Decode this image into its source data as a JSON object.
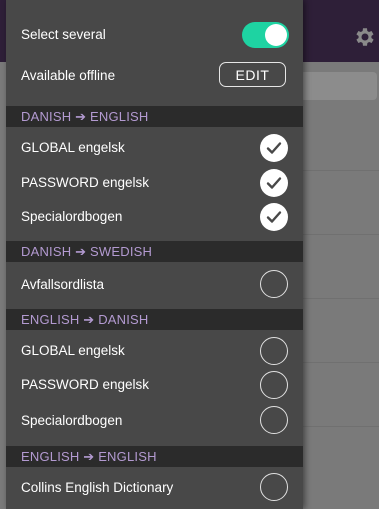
{
  "drawer": {
    "select_several_label": "Select several",
    "select_several_on": true,
    "available_offline_label": "Available offline",
    "edit_label": "EDIT",
    "sections": [
      {
        "title": "DANISH ➔ ENGLISH",
        "items": [
          {
            "label": "GLOBAL engelsk",
            "checked": true
          },
          {
            "label": "PASSWORD engelsk",
            "checked": true
          },
          {
            "label": "Specialordbogen",
            "checked": true
          }
        ]
      },
      {
        "title": "DANISH ➔ SWEDISH",
        "items": [
          {
            "label": "Avfallsordlista",
            "checked": false
          }
        ]
      },
      {
        "title": "ENGLISH ➔ DANISH",
        "items": [
          {
            "label": "GLOBAL engelsk",
            "checked": false
          },
          {
            "label": "PASSWORD engelsk",
            "checked": false
          },
          {
            "label": "Specialordbogen",
            "checked": false
          }
        ]
      },
      {
        "title": "ENGLISH ➔ ENGLISH",
        "items": [
          {
            "label": "Collins English Dictionary",
            "checked": false
          }
        ]
      }
    ]
  },
  "colors": {
    "toggle_on": "#1ed3a2",
    "section_text": "#b39ad1",
    "drawer_bg": "#484848",
    "section_bg": "#2b2b2b"
  },
  "icons": {
    "settings": "gear-icon",
    "checked": "checkmark-circle-icon",
    "unchecked": "empty-circle-icon"
  }
}
